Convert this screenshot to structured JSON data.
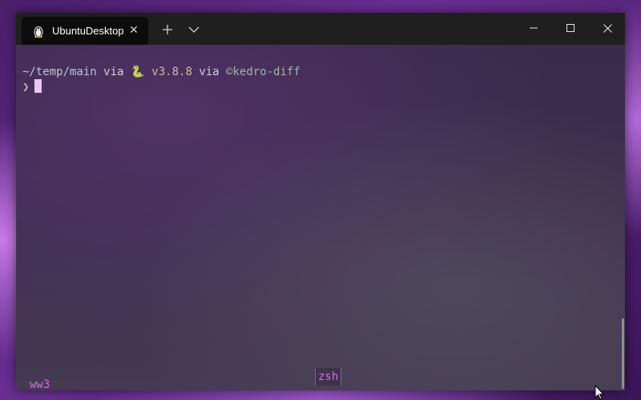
{
  "window": {
    "tab_title": "UbuntuDesktop",
    "tab_icon": "linux-penguin-icon",
    "close_tab_glyph": "✕",
    "controls": {
      "minimize": "minimize-icon",
      "maximize": "maximize-icon",
      "close": "close-icon"
    }
  },
  "terminal": {
    "line1": {
      "path": "~/temp/main",
      "via1": " via ",
      "python_icon": "python-icon",
      "python_glyph": "🐍",
      "version": " v3.8.8",
      "via2": " via ",
      "env": "©kedro-diff"
    },
    "prompt_symbol": "❯"
  },
  "statusbar": {
    "left": "ww3",
    "center": "zsh"
  },
  "colors": {
    "accent_status": "#c86fe0",
    "cursor": "#eac7ee",
    "version": "#c9c28a",
    "env": "#9fb8a4"
  }
}
